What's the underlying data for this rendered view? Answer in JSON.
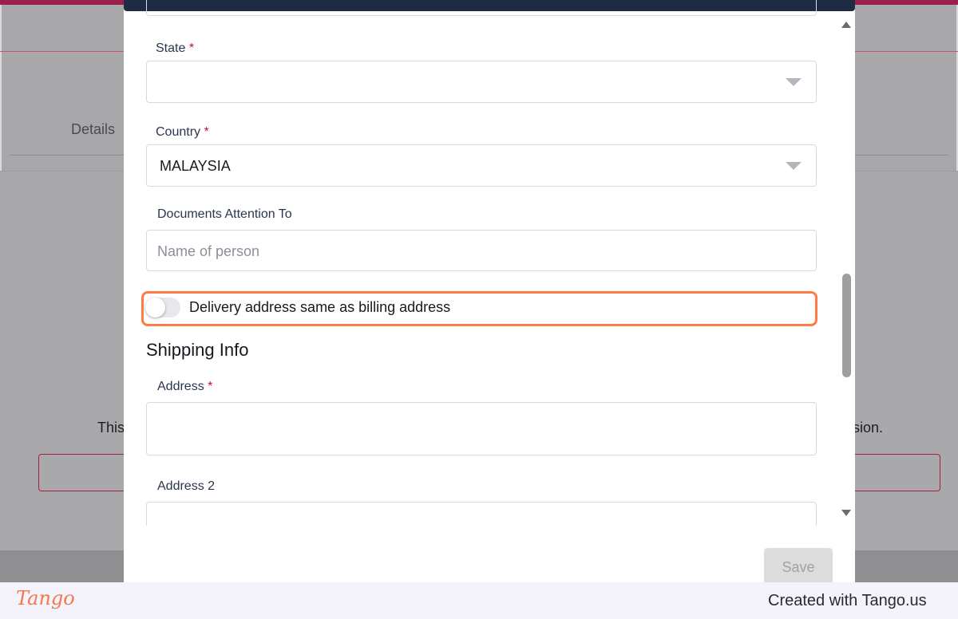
{
  "background": {
    "tab_details": "Details",
    "text_left": "This",
    "text_right": "sion."
  },
  "form": {
    "state": {
      "label": "State",
      "required_mark": "*",
      "value": ""
    },
    "country": {
      "label": "Country",
      "required_mark": "*",
      "value": "MALAYSIA"
    },
    "documents_attention": {
      "label": "Documents Attention To",
      "placeholder": "Name of person"
    },
    "delivery_toggle": {
      "label": "Delivery address same as billing address",
      "checked": false
    },
    "shipping_title": "Shipping Info",
    "address": {
      "label": "Address",
      "required_mark": "*",
      "value": ""
    },
    "address2": {
      "label": "Address 2",
      "value": ""
    },
    "save_label": "Save"
  },
  "footer": {
    "logo": "Tango",
    "credit": "Created with Tango.us"
  },
  "colors": {
    "highlight": "#ff7a45",
    "brand_accent": "#9b1f4a",
    "modal_header": "#1f2a44"
  }
}
